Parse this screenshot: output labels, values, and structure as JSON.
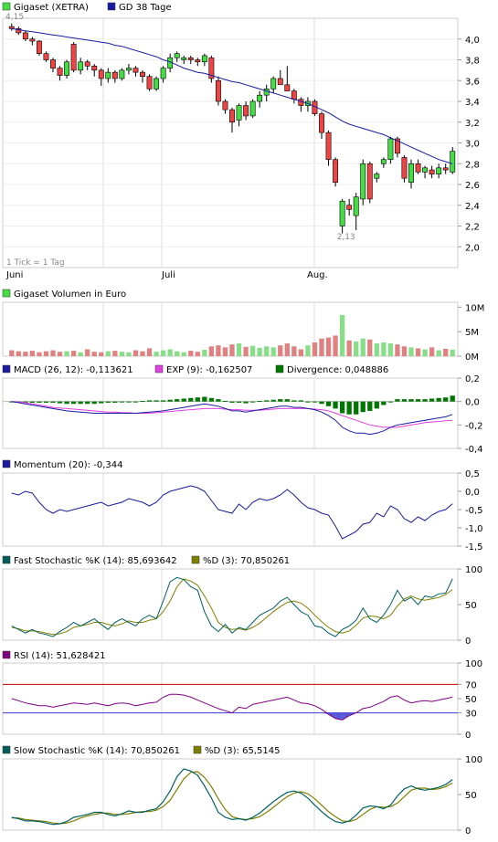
{
  "colors": {
    "up": "#44dd44",
    "down": "#ee4444",
    "ma": "#1a1aa0",
    "macd": "#1a1aa0",
    "signal": "#e040e0",
    "divergence": "#007700",
    "stoch_k": "#006060",
    "stoch_d": "#808000",
    "rsi": "#800080",
    "rsi_band": "#cc0000",
    "rsi_low": "#3a3ad0"
  },
  "icons": {
    "legend_swatch": "square-swatch-icon"
  },
  "price": {
    "legend": [
      {
        "label": "Gigaset (XETRA)",
        "color": "#44dd44"
      },
      {
        "label": "GD 38 Tage",
        "color": "#1a1aa0"
      }
    ],
    "high_label": "4,15",
    "low_label": "2,13",
    "tick_note": "1 Tick = 1 Tag",
    "yticks": [
      "4,0",
      "3,8",
      "3,6",
      "3,4",
      "3,2",
      "3,0",
      "2,8",
      "2,6",
      "2,4",
      "2,2",
      "2,0"
    ],
    "xlabels": [
      "Juni",
      "Juli",
      "Aug."
    ]
  },
  "volume": {
    "legend": "Gigaset Volumen in Euro",
    "yticks": [
      "10M",
      "5M",
      "0M"
    ]
  },
  "macd": {
    "legend": [
      {
        "label": "MACD (26, 12): -0,113621",
        "color": "#1a1aa0"
      },
      {
        "label": "EXP (9): -0,162507",
        "color": "#e040e0"
      },
      {
        "label": "Divergence: 0,048886",
        "color": "#007700"
      }
    ],
    "yticks": [
      "0,2",
      "0,0",
      "-0,2",
      "-0,4"
    ]
  },
  "momentum": {
    "legend": "Momentum (20): -0,344",
    "yticks": [
      "0,5",
      "0,0",
      "-0,5",
      "-1,0",
      "-1,5"
    ]
  },
  "fast_stoch": {
    "legend": [
      {
        "label": "Fast Stochastic %K (14): 85,693642",
        "color": "#006060"
      },
      {
        "label": "%D (3): 70,850261",
        "color": "#808000"
      }
    ],
    "yticks": [
      "100",
      "50",
      "0"
    ]
  },
  "rsi": {
    "legend": "RSI (14): 51,628421",
    "yticks": [
      "100",
      "70",
      "50",
      "30",
      "0"
    ]
  },
  "slow_stoch": {
    "legend": [
      {
        "label": "Slow Stochastic %K (14): 70,850261",
        "color": "#006060"
      },
      {
        "label": "%D (3): 65,5145",
        "color": "#808000"
      }
    ],
    "yticks": [
      "100",
      "50",
      "0"
    ]
  },
  "chart_data": {
    "type": "candlestick",
    "x_labels": [
      "Juni",
      "Juli",
      "Aug."
    ],
    "candles": [
      [
        4.12,
        4.15,
        4.08,
        4.1
      ],
      [
        4.1,
        4.12,
        4.04,
        4.06
      ],
      [
        4.06,
        4.08,
        3.98,
        4.0
      ],
      [
        4.0,
        4.02,
        3.94,
        3.98
      ],
      [
        3.98,
        3.99,
        3.84,
        3.86
      ],
      [
        3.86,
        3.88,
        3.78,
        3.8
      ],
      [
        3.8,
        3.82,
        3.68,
        3.72
      ],
      [
        3.72,
        3.74,
        3.6,
        3.65
      ],
      [
        3.65,
        3.8,
        3.62,
        3.78
      ],
      [
        3.95,
        3.97,
        3.68,
        3.7
      ],
      [
        3.7,
        3.82,
        3.66,
        3.78
      ],
      [
        3.78,
        3.8,
        3.7,
        3.74
      ],
      [
        3.74,
        3.76,
        3.64,
        3.7
      ],
      [
        3.7,
        3.72,
        3.55,
        3.62
      ],
      [
        3.62,
        3.72,
        3.58,
        3.68
      ],
      [
        3.68,
        3.7,
        3.58,
        3.62
      ],
      [
        3.62,
        3.72,
        3.6,
        3.7
      ],
      [
        3.7,
        3.76,
        3.66,
        3.72
      ],
      [
        3.72,
        3.74,
        3.64,
        3.68
      ],
      [
        3.68,
        3.7,
        3.58,
        3.64
      ],
      [
        3.64,
        3.66,
        3.5,
        3.52
      ],
      [
        3.52,
        3.64,
        3.5,
        3.62
      ],
      [
        3.62,
        3.74,
        3.58,
        3.72
      ],
      [
        3.72,
        3.86,
        3.68,
        3.82
      ],
      [
        3.82,
        3.88,
        3.78,
        3.86
      ],
      [
        3.8,
        3.84,
        3.76,
        3.82
      ],
      [
        3.82,
        3.84,
        3.76,
        3.8
      ],
      [
        3.8,
        3.82,
        3.74,
        3.78
      ],
      [
        3.78,
        3.86,
        3.74,
        3.84
      ],
      [
        3.82,
        3.84,
        3.58,
        3.62
      ],
      [
        3.6,
        3.64,
        3.36,
        3.4
      ],
      [
        3.4,
        3.42,
        3.28,
        3.32
      ],
      [
        3.32,
        3.34,
        3.1,
        3.2
      ],
      [
        3.22,
        3.38,
        3.16,
        3.36
      ],
      [
        3.36,
        3.4,
        3.22,
        3.26
      ],
      [
        3.26,
        3.42,
        3.24,
        3.4
      ],
      [
        3.4,
        3.5,
        3.34,
        3.46
      ],
      [
        3.46,
        3.56,
        3.4,
        3.52
      ],
      [
        3.52,
        3.64,
        3.48,
        3.62
      ],
      [
        3.62,
        3.7,
        3.56,
        3.56
      ],
      [
        3.56,
        3.74,
        3.52,
        3.5
      ],
      [
        3.5,
        3.52,
        3.38,
        3.42
      ],
      [
        3.42,
        3.44,
        3.3,
        3.36
      ],
      [
        3.36,
        3.44,
        3.3,
        3.4
      ],
      [
        3.4,
        3.42,
        3.26,
        3.28
      ],
      [
        3.28,
        3.3,
        3.04,
        3.1
      ],
      [
        3.1,
        3.12,
        2.78,
        2.84
      ],
      [
        2.84,
        2.86,
        2.58,
        2.62
      ],
      [
        2.2,
        2.46,
        2.13,
        2.44
      ],
      [
        2.4,
        2.46,
        2.3,
        2.36
      ],
      [
        2.3,
        2.52,
        2.16,
        2.48
      ],
      [
        2.46,
        2.84,
        2.4,
        2.8
      ],
      [
        2.8,
        2.82,
        2.42,
        2.46
      ],
      [
        2.66,
        2.72,
        2.62,
        2.7
      ],
      [
        2.8,
        2.86,
        2.76,
        2.84
      ],
      [
        2.84,
        3.06,
        2.8,
        3.04
      ],
      [
        3.04,
        3.06,
        2.86,
        2.9
      ],
      [
        2.86,
        2.88,
        2.62,
        2.66
      ],
      [
        2.62,
        2.84,
        2.56,
        2.8
      ],
      [
        2.8,
        2.84,
        2.7,
        2.72
      ],
      [
        2.72,
        2.78,
        2.66,
        2.76
      ],
      [
        2.74,
        2.78,
        2.66,
        2.7
      ],
      [
        2.7,
        2.8,
        2.66,
        2.76
      ],
      [
        2.76,
        2.8,
        2.7,
        2.74
      ],
      [
        2.72,
        2.96,
        2.7,
        2.92
      ]
    ],
    "ma38": [
      4.1,
      4.09,
      4.08,
      4.07,
      4.06,
      4.05,
      4.04,
      4.03,
      4.02,
      4.01,
      4.0,
      3.99,
      3.98,
      3.97,
      3.96,
      3.94,
      3.93,
      3.91,
      3.89,
      3.87,
      3.85,
      3.83,
      3.8,
      3.78,
      3.75,
      3.72,
      3.7,
      3.68,
      3.67,
      3.65,
      3.63,
      3.61,
      3.59,
      3.58,
      3.56,
      3.54,
      3.52,
      3.5,
      3.48,
      3.46,
      3.44,
      3.42,
      3.4,
      3.38,
      3.35,
      3.32,
      3.29,
      3.25,
      3.21,
      3.18,
      3.16,
      3.14,
      3.12,
      3.1,
      3.08,
      3.05,
      3.02,
      2.99,
      2.96,
      2.93,
      2.9,
      2.87,
      2.84,
      2.82,
      2.8
    ],
    "volume_millions": [
      1.2,
      1.0,
      0.9,
      1.1,
      0.8,
      1.0,
      1.2,
      0.9,
      1.0,
      1.1,
      0.8,
      1.4,
      0.9,
      0.8,
      1.0,
      1.1,
      0.9,
      0.8,
      1.2,
      1.0,
      1.6,
      0.9,
      1.2,
      1.4,
      1.0,
      0.8,
      1.1,
      0.9,
      1.3,
      2.0,
      2.2,
      1.8,
      2.4,
      2.6,
      1.9,
      2.1,
      1.7,
      2.0,
      1.8,
      2.2,
      2.6,
      2.0,
      1.4,
      2.2,
      2.8,
      3.6,
      3.8,
      4.2,
      8.4,
      3.2,
      3.0,
      3.6,
      3.4,
      2.6,
      2.8,
      2.6,
      2.4,
      2.0,
      1.8,
      1.6,
      1.4,
      1.8,
      1.2,
      1.5,
      1.3
    ],
    "macd": [
      0.0,
      -0.01,
      -0.02,
      -0.03,
      -0.04,
      -0.05,
      -0.06,
      -0.07,
      -0.08,
      -0.085,
      -0.09,
      -0.095,
      -0.1,
      -0.1,
      -0.1,
      -0.1,
      -0.1,
      -0.1,
      -0.1,
      -0.095,
      -0.09,
      -0.085,
      -0.08,
      -0.07,
      -0.06,
      -0.05,
      -0.04,
      -0.03,
      -0.02,
      -0.03,
      -0.04,
      -0.06,
      -0.08,
      -0.08,
      -0.09,
      -0.08,
      -0.07,
      -0.06,
      -0.05,
      -0.04,
      -0.04,
      -0.05,
      -0.05,
      -0.06,
      -0.07,
      -0.09,
      -0.12,
      -0.16,
      -0.22,
      -0.25,
      -0.27,
      -0.27,
      -0.28,
      -0.27,
      -0.25,
      -0.22,
      -0.2,
      -0.19,
      -0.18,
      -0.17,
      -0.16,
      -0.15,
      -0.14,
      -0.13,
      -0.11
    ],
    "macd_signal": [
      0.0,
      -0.005,
      -0.01,
      -0.02,
      -0.03,
      -0.04,
      -0.05,
      -0.055,
      -0.06,
      -0.065,
      -0.07,
      -0.075,
      -0.08,
      -0.085,
      -0.09,
      -0.09,
      -0.095,
      -0.095,
      -0.1,
      -0.1,
      -0.1,
      -0.095,
      -0.09,
      -0.085,
      -0.08,
      -0.075,
      -0.07,
      -0.065,
      -0.06,
      -0.06,
      -0.06,
      -0.065,
      -0.07,
      -0.07,
      -0.075,
      -0.075,
      -0.075,
      -0.07,
      -0.065,
      -0.06,
      -0.06,
      -0.06,
      -0.06,
      -0.06,
      -0.065,
      -0.07,
      -0.08,
      -0.1,
      -0.12,
      -0.14,
      -0.16,
      -0.18,
      -0.2,
      -0.21,
      -0.22,
      -0.22,
      -0.22,
      -0.21,
      -0.2,
      -0.19,
      -0.18,
      -0.175,
      -0.17,
      -0.165,
      -0.16
    ],
    "divergence": [
      0.0,
      -0.005,
      -0.01,
      -0.01,
      -0.01,
      -0.01,
      -0.01,
      -0.015,
      -0.02,
      -0.02,
      -0.02,
      -0.02,
      -0.02,
      -0.015,
      -0.01,
      -0.01,
      -0.005,
      -0.005,
      0.0,
      0.005,
      0.01,
      0.01,
      0.01,
      0.015,
      0.02,
      0.025,
      0.03,
      0.035,
      0.04,
      0.03,
      0.02,
      0.005,
      -0.01,
      -0.01,
      -0.015,
      -0.005,
      0.005,
      0.01,
      0.015,
      0.02,
      0.02,
      0.01,
      0.01,
      0.0,
      -0.005,
      -0.02,
      -0.04,
      -0.06,
      -0.1,
      -0.11,
      -0.11,
      -0.09,
      -0.08,
      -0.06,
      -0.03,
      0.0,
      0.02,
      0.02,
      0.02,
      0.02,
      0.02,
      0.025,
      0.03,
      0.035,
      0.05
    ],
    "momentum": [
      -0.05,
      -0.1,
      0.0,
      -0.05,
      -0.3,
      -0.5,
      -0.6,
      -0.5,
      -0.55,
      -0.5,
      -0.45,
      -0.4,
      -0.35,
      -0.3,
      -0.4,
      -0.35,
      -0.3,
      -0.2,
      -0.25,
      -0.3,
      -0.4,
      -0.3,
      -0.1,
      0.0,
      0.05,
      0.1,
      0.15,
      0.1,
      0.0,
      -0.25,
      -0.5,
      -0.55,
      -0.6,
      -0.35,
      -0.5,
      -0.3,
      -0.2,
      -0.25,
      -0.2,
      -0.1,
      0.05,
      -0.1,
      -0.3,
      -0.45,
      -0.5,
      -0.6,
      -0.65,
      -0.95,
      -1.3,
      -1.2,
      -1.1,
      -0.9,
      -0.85,
      -0.6,
      -0.7,
      -0.4,
      -0.5,
      -0.75,
      -0.85,
      -0.7,
      -0.8,
      -0.65,
      -0.55,
      -0.5,
      -0.34
    ],
    "fast_stoch_k": [
      20,
      15,
      10,
      15,
      10,
      8,
      5,
      12,
      18,
      25,
      20,
      25,
      30,
      22,
      15,
      25,
      30,
      25,
      20,
      30,
      35,
      30,
      55,
      82,
      88,
      85,
      75,
      70,
      40,
      20,
      12,
      22,
      10,
      18,
      15,
      25,
      35,
      40,
      45,
      55,
      60,
      50,
      40,
      35,
      20,
      18,
      10,
      5,
      15,
      20,
      28,
      45,
      30,
      25,
      35,
      50,
      70,
      55,
      60,
      50,
      62,
      60,
      65,
      66,
      86
    ],
    "fast_stoch_d": [
      18,
      16,
      13,
      13,
      12,
      10,
      8,
      9,
      12,
      18,
      20,
      22,
      25,
      25,
      22,
      20,
      23,
      27,
      25,
      25,
      28,
      30,
      40,
      55,
      75,
      86,
      83,
      77,
      62,
      45,
      25,
      18,
      15,
      16,
      14,
      18,
      24,
      32,
      40,
      47,
      53,
      55,
      52,
      45,
      35,
      26,
      18,
      12,
      10,
      13,
      21,
      31,
      34,
      33,
      30,
      35,
      48,
      58,
      62,
      58,
      56,
      58,
      60,
      64,
      71
    ],
    "rsi": [
      50,
      47,
      44,
      42,
      40,
      40,
      38,
      40,
      42,
      44,
      43,
      42,
      44,
      42,
      40,
      43,
      44,
      43,
      40,
      42,
      44,
      45,
      52,
      56,
      56,
      55,
      52,
      48,
      44,
      40,
      36,
      33,
      30,
      38,
      36,
      42,
      44,
      46,
      48,
      50,
      52,
      48,
      44,
      43,
      40,
      35,
      28,
      22,
      20,
      26,
      30,
      36,
      38,
      42,
      46,
      52,
      54,
      48,
      44,
      46,
      47,
      46,
      48,
      50,
      52
    ],
    "slow_stoch_k": [
      18,
      16,
      13,
      13,
      12,
      10,
      8,
      9,
      12,
      18,
      20,
      22,
      25,
      25,
      22,
      20,
      23,
      27,
      25,
      25,
      28,
      30,
      40,
      55,
      75,
      86,
      83,
      77,
      62,
      45,
      25,
      18,
      15,
      16,
      14,
      18,
      24,
      32,
      40,
      47,
      53,
      55,
      52,
      45,
      35,
      26,
      18,
      12,
      10,
      13,
      21,
      31,
      34,
      33,
      30,
      35,
      48,
      58,
      62,
      58,
      56,
      58,
      60,
      64,
      71
    ],
    "slow_stoch_d": [
      17,
      17,
      15,
      14,
      13,
      12,
      10,
      9,
      10,
      13,
      17,
      20,
      22,
      24,
      24,
      22,
      22,
      23,
      25,
      26,
      26,
      28,
      33,
      42,
      57,
      72,
      81,
      82,
      74,
      61,
      44,
      29,
      19,
      16,
      15,
      16,
      19,
      25,
      32,
      40,
      47,
      52,
      54,
      51,
      44,
      35,
      26,
      19,
      13,
      12,
      15,
      22,
      29,
      33,
      32,
      33,
      38,
      47,
      56,
      59,
      59,
      57,
      58,
      61,
      66
    ]
  }
}
